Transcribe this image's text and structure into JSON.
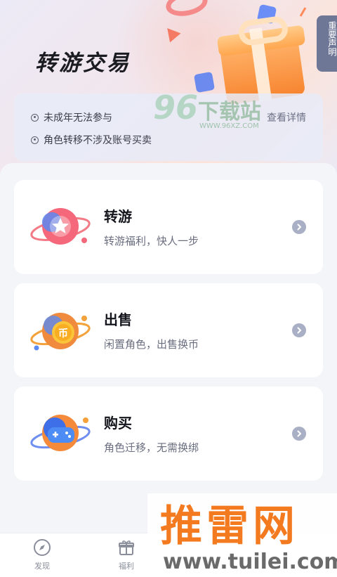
{
  "header": {
    "title": "转游交易",
    "notice_tab": "重要声明"
  },
  "notice": {
    "items": [
      "未成年无法参与",
      "角色转移不涉及账号买卖"
    ],
    "details_link": "查看详情"
  },
  "cards": [
    {
      "title": "转游",
      "subtitle": "转游福利，快人一步",
      "icon": "star-planet-icon"
    },
    {
      "title": "出售",
      "subtitle": "闲置角色，出售换币",
      "icon": "coin-planet-icon"
    },
    {
      "title": "购买",
      "subtitle": "角色迁移，无需换绑",
      "icon": "gamepad-planet-icon"
    }
  ],
  "tabbar": {
    "items": [
      {
        "label": "发现",
        "icon": "compass-icon"
      },
      {
        "label": "福利",
        "icon": "gift-box-icon"
      }
    ]
  },
  "watermarks": {
    "site1_number": "96",
    "site1_text": "下载站",
    "site1_url": "WWW.96XZ.COM",
    "site2_text": "推雷网",
    "site2_url": "www.tuilei.com"
  },
  "colors": {
    "accent_orange": "#f7842f",
    "arrow_gray": "#a9afc4",
    "notice_tab_bg": "#6f7796"
  }
}
